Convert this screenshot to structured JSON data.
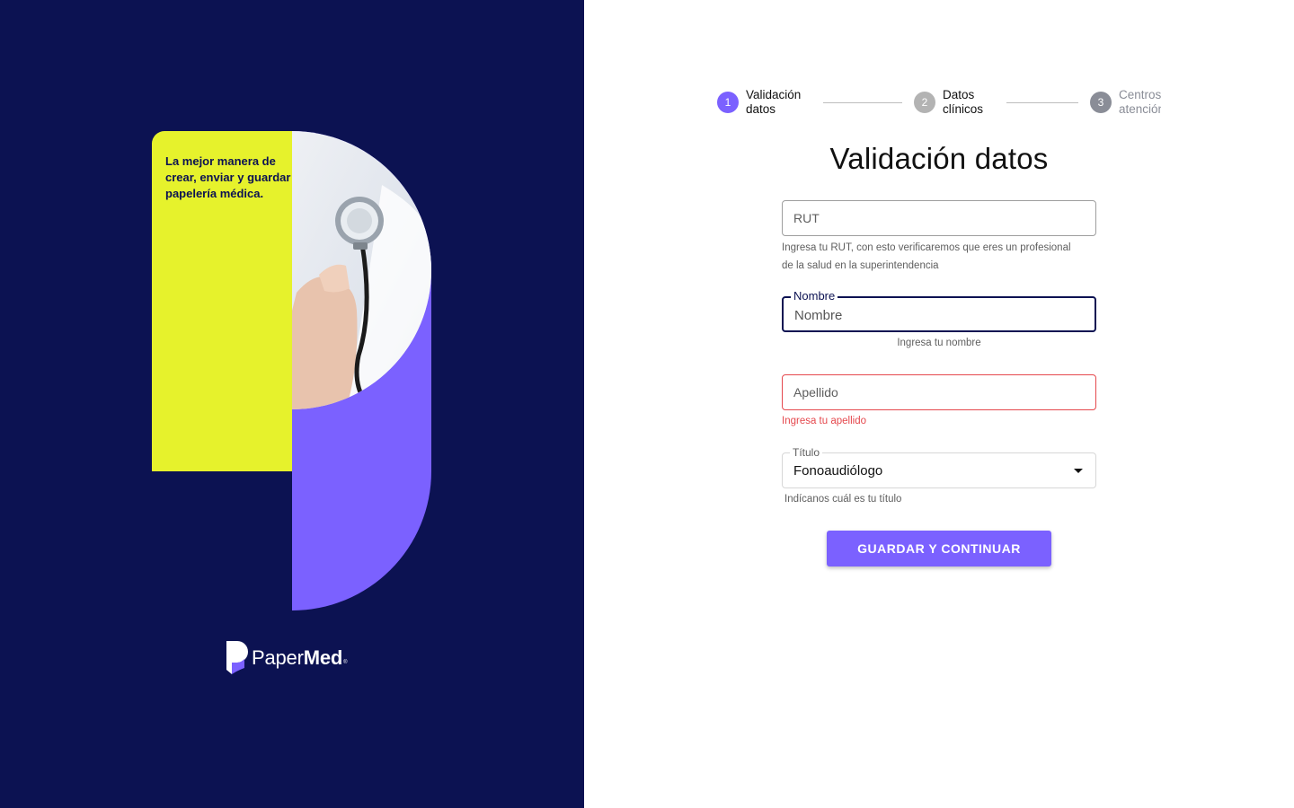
{
  "brand": {
    "tagline": "La mejor manera de crear, enviar  y guardar papelería médica.",
    "logo_part1": "Paper",
    "logo_part2": "Med",
    "logo_mark": "®",
    "colors": {
      "navy": "#0c1252",
      "yellow": "#e6f22c",
      "purple": "#7b61ff"
    }
  },
  "stepper": {
    "steps": [
      {
        "number": "1",
        "label": "Validación\ndatos",
        "state": "active",
        "color": "#7b61ff"
      },
      {
        "number": "2",
        "label": "Datos\nclínicos",
        "state": "pending",
        "color": "#b3b3b3"
      },
      {
        "number": "3",
        "label": "Centros\natención",
        "state": "pending",
        "color": "#8a8d97"
      }
    ]
  },
  "form": {
    "title": "Validación datos",
    "rut": {
      "placeholder": "RUT",
      "value": "",
      "helper": "Ingresa tu RUT, con esto verificaremos que eres un profesional de la salud en la superintendencia"
    },
    "nombre": {
      "label": "Nombre",
      "placeholder": "Nombre",
      "value": "",
      "helper": "Ingresa tu nombre"
    },
    "apellido": {
      "placeholder": "Apellido",
      "value": "",
      "helper": "Ingresa tu apellido",
      "error_color": "#e5484d"
    },
    "titulo": {
      "label": "Título",
      "value": "Fonoaudiólogo",
      "helper": "Indícanos cuál es tu título"
    },
    "submit_label": "GUARDAR Y CONTINUAR"
  }
}
